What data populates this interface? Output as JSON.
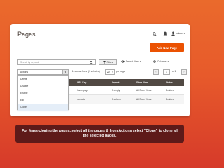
{
  "header": {
    "title": "Pages",
    "username": "admin",
    "add_button": "Add New Page"
  },
  "toolbar": {
    "search_placeholder": "Search by keyword",
    "filters_label": "Filters",
    "view_label": "Default View",
    "columns_label": "Columns"
  },
  "actions": {
    "selected": "Actions",
    "options": [
      "Delete",
      "Disable",
      "Enable",
      "Edit",
      "Clone"
    ],
    "highlighted": "Clone"
  },
  "records": {
    "text": "2 records found (1 selected)",
    "per_page": "20",
    "per_page_label": "per page",
    "page": "1",
    "of": "of 1"
  },
  "grid": {
    "columns": [
      "URL Key",
      "Layout",
      "Store View",
      "Status"
    ],
    "rows": [
      {
        "url_key": "home-page",
        "layout": "1 empty",
        "store_view": "All Store Views",
        "status": "Enabled"
      },
      {
        "url_key": "no-route",
        "layout": "1 column",
        "store_view": "All Store Views",
        "status": "Enabled"
      }
    ]
  },
  "note": {
    "text": "For Mass cloning the pages, select all the pages & from Actions select \"Clone\" to clone all the selected pages."
  },
  "colors": {
    "accent": "#eb5202",
    "grid_header": "#514943",
    "note_bg": "#5e1a19"
  },
  "icons": [
    "search-icon",
    "bell-icon",
    "user-icon",
    "filter-icon",
    "eye-icon",
    "gear-icon"
  ]
}
